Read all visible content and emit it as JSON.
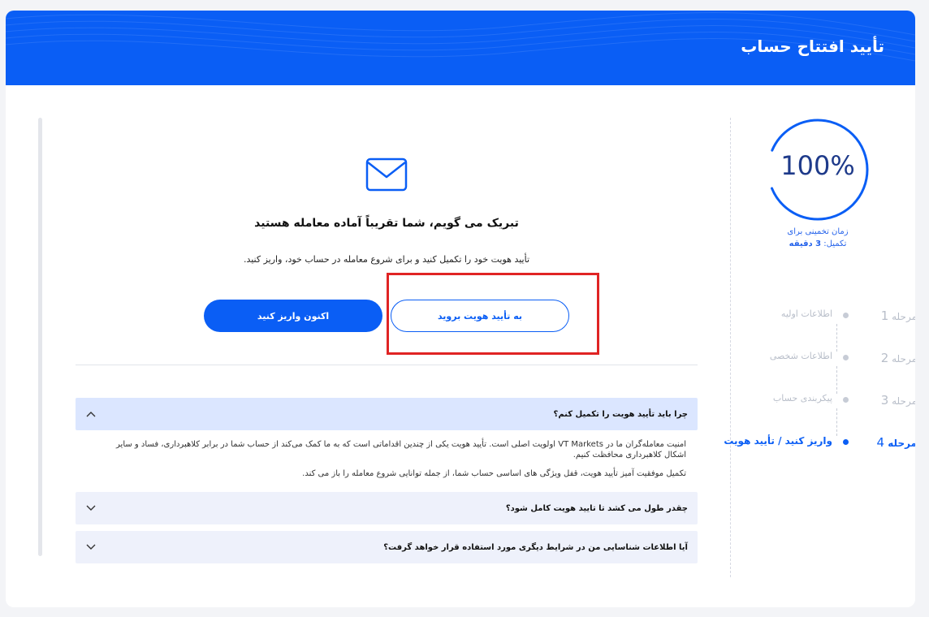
{
  "header": {
    "title": "تأیید افتتاح حساب"
  },
  "progress": {
    "percent_text": "100%",
    "percent": 100
  },
  "eta": {
    "line1": "زمان تخمینی برای",
    "line2_prefix": "تکمیل: ",
    "line2_value": "3 دقیقه"
  },
  "steps": [
    {
      "number_prefix": "مرحله ",
      "number": "1",
      "label": "اطلاعات اولیه",
      "active": false
    },
    {
      "number_prefix": "مرحله ",
      "number": "2",
      "label": "اطلاعات شخصی",
      "active": false
    },
    {
      "number_prefix": "مرحله ",
      "number": "3",
      "label": "پیکربندی حساب",
      "active": false
    },
    {
      "number_prefix": "مرحله ",
      "number": "4",
      "label": "واریز کنید / تأیید هویت",
      "active": true
    }
  ],
  "main": {
    "icon": "mail-icon",
    "headline": "تبریک می گویم، شما تقریباً آماده معامله هستید",
    "subline": "تأیید هویت خود را تکمیل کنید و برای شروع معامله در حساب خود، واریز کنید.",
    "deposit_button": "اکنون واریز کنید",
    "verify_button": "به تأیید هویت بروید"
  },
  "faq": [
    {
      "question": "چرا باید تأیید هویت را تکمیل کنم؟",
      "expanded": true,
      "answer_p1": "امنیت معامله‌گران ما در VT Markets اولویت اصلی است. تأیید هویت یکی از چندین اقداماتی است که به ما کمک می‌کند از حساب شما در برابر کلاهبرداری، فساد و سایر اشکال کلاهبرداری محافظت کنیم.",
      "answer_p2": "تکمیل موفقیت آمیز تأیید هویت، قفل ویژگی های اساسی حساب شما، از جمله توانایی شروع معامله را باز می کند."
    },
    {
      "question": "چقدر طول می کشد تا تایید هویت کامل شود؟",
      "expanded": false
    },
    {
      "question": "آیا اطلاعات شناسایی من در شرایط دیگری مورد استفاده قرار خواهد گرفت؟",
      "expanded": false
    }
  ],
  "colors": {
    "brand": "#0a5ef5",
    "highlight": "#e02424"
  }
}
